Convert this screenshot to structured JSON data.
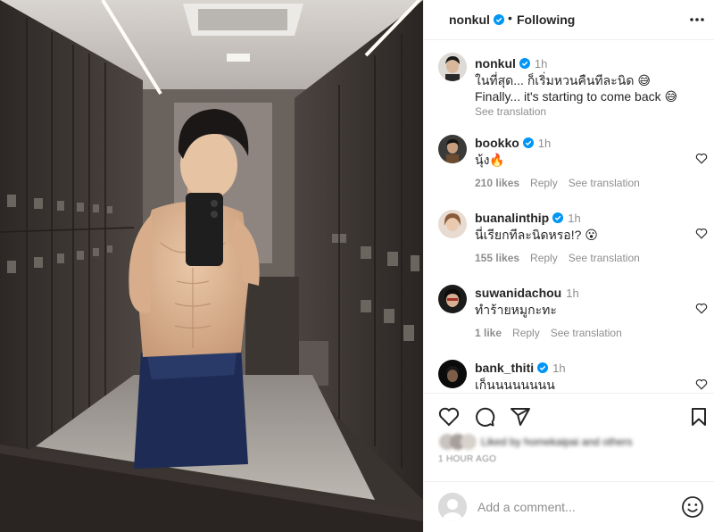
{
  "post": {
    "username": "nonkul",
    "following_label": "Following",
    "dot": "•"
  },
  "caption": {
    "username": "nonkul",
    "time": "1h",
    "line1": "ในที่สุด... ก็เริ่มหวนคืนทีละนิด 😅",
    "line2": "Finally... it's starting to come back 😅",
    "see_translation": "See translation"
  },
  "comments": [
    {
      "username": "bookko",
      "verified": true,
      "time": "1h",
      "text": "นุ้ง🔥",
      "likes": "210 likes",
      "reply": "Reply",
      "see_translation": "See translation"
    },
    {
      "username": "buanalinthip",
      "verified": true,
      "time": "1h",
      "text": "นี่เรียกทีละนิดหรอ!? 😮",
      "likes": "155 likes",
      "reply": "Reply",
      "see_translation": "See translation"
    },
    {
      "username": "suwanidachou",
      "verified": false,
      "time": "1h",
      "text": "ทำร้ายหมูกะทะ",
      "likes": "1 like",
      "reply": "Reply",
      "see_translation": "See translation"
    },
    {
      "username": "bank_thiti",
      "verified": true,
      "time": "1h",
      "text": "เก็นนนนนนนน",
      "likes": "",
      "reply": "",
      "see_translation": ""
    }
  ],
  "actions": {
    "liked_by": "Liked by homekaipai and others",
    "time_ago": "1 HOUR AGO"
  },
  "composer": {
    "placeholder": "Add a comment..."
  },
  "icons": {
    "verified": "verified-badge-icon",
    "more": "more-options-icon",
    "heart": "heart-icon",
    "comment": "comment-icon",
    "share": "share-icon",
    "save": "bookmark-icon",
    "emoji": "emoji-icon"
  },
  "colors": {
    "verified_blue": "#0095f6",
    "text": "#262626",
    "muted": "#8e8e8e"
  }
}
